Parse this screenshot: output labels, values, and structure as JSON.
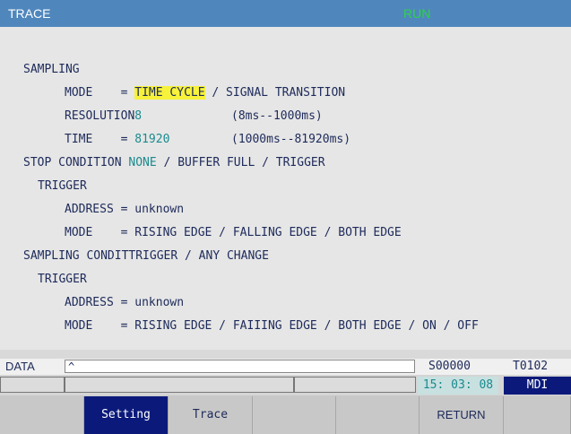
{
  "header": {
    "title": "TRACE",
    "status": "RUN"
  },
  "content": {
    "sampling_title": "SAMPLING",
    "mode_label": "MODE    = ",
    "mode_selected": "TIME CYCLE",
    "mode_rest": " / SIGNAL TRANSITION",
    "resolution_label": "RESOLUTION",
    "resolution_value": "8",
    "resolution_range": "(8ms--1000ms)",
    "time_label": "TIME    = ",
    "time_value": "81920",
    "time_range": "(1000ms--81920ms)",
    "stop_label": "STOP CONDITION ",
    "stop_selected": "NONE",
    "stop_rest": " / BUFFER FULL / TRIGGER",
    "trigger1_title": "TRIGGER",
    "address1": "ADDRESS = unknown",
    "mode1": "MODE    = RISING EDGE / FALLING EDGE / BOTH EDGE",
    "sampcond": "SAMPLING CONDITTRIGGER / ANY CHANGE",
    "trigger2_title": "TRIGGER",
    "address2": "ADDRESS = unknown",
    "mode2": "MODE    = RISING EDGE / FAIIING EDGE / BOTH EDGE / ON / OFF"
  },
  "dataline": {
    "label": "DATA",
    "input_value": "^",
    "s_code": "S00000",
    "t_code": "T0102"
  },
  "statusline": {
    "time": "15: 03: 08",
    "mode": "MDI"
  },
  "softkeys": [
    "",
    "Setting",
    "Trace",
    "",
    "",
    "RETURN",
    ""
  ],
  "colors": {
    "title_bg": "#4f87bd",
    "status_green": "#2fd24a",
    "highlight": "#f7f23a",
    "teal_value": "#1b8a8e",
    "active_key": "#0b1a7a"
  }
}
